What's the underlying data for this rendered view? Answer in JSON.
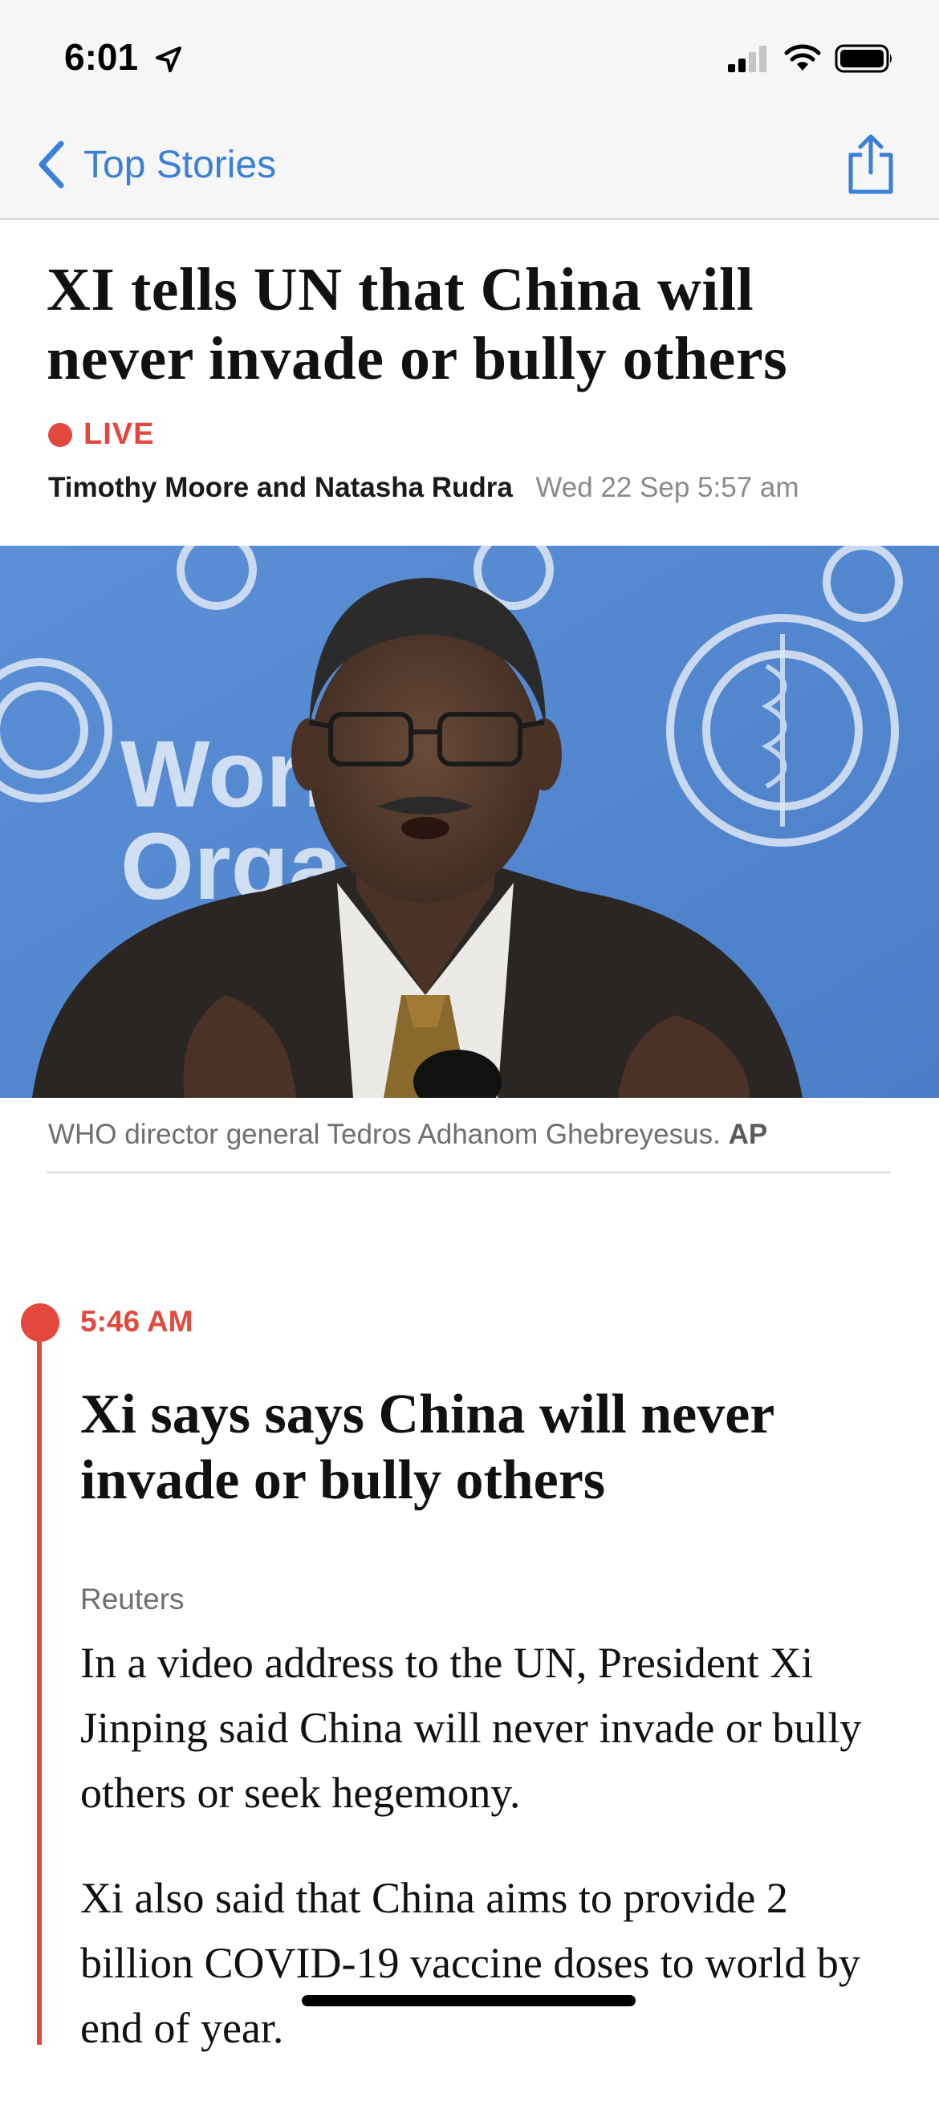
{
  "status_bar": {
    "time": "6:01"
  },
  "nav": {
    "back_label": "Top Stories"
  },
  "article": {
    "headline": "XI tells UN that China will never invade or bully others",
    "live_label": "LIVE",
    "authors": "Timothy Moore and Natasha Rudra",
    "date": "Wed 22 Sep 5:57 am",
    "caption": "WHO director general Tedros Adhanom Ghebreyesus.",
    "caption_credit": "AP",
    "hero_background_text": [
      "World",
      "Organ"
    ]
  },
  "live_post": {
    "time": "5:46 AM",
    "title": "Xi says says China will never invade or bully others",
    "source": "Reuters",
    "paragraphs": [
      "In a video address to the UN, President Xi Jinping said China will never invade or bully others or seek hegemony.",
      "Xi also said that China aims to provide 2 billion COVID-19 vaccine doses to world by end of year."
    ]
  },
  "colors": {
    "accent_blue": "#3a7fd8",
    "live_red": "#e2483d",
    "hero_blue": "#4f86cf"
  }
}
